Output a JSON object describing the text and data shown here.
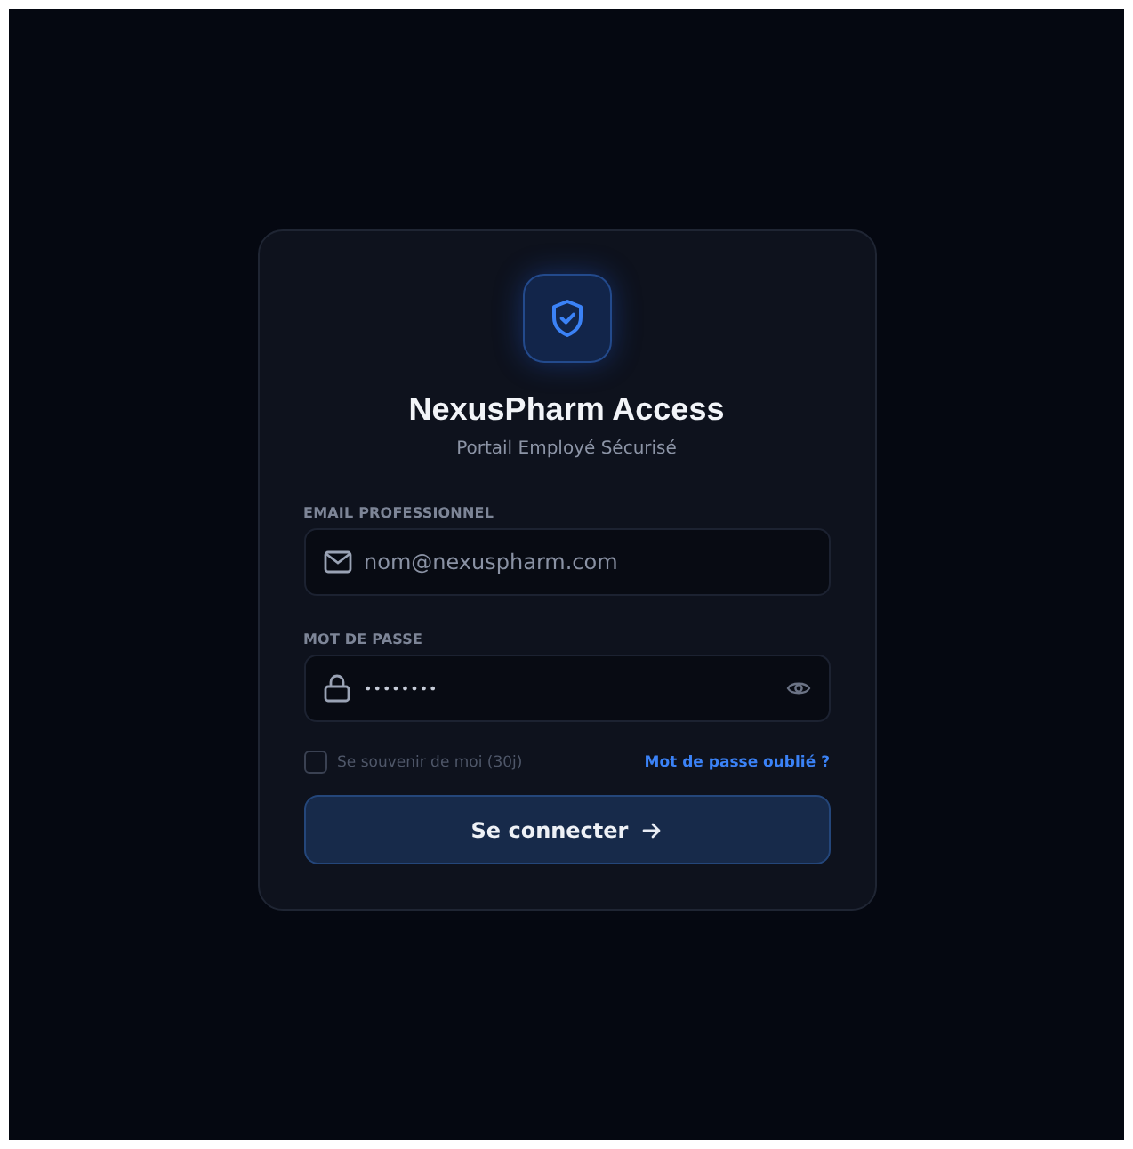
{
  "header": {
    "title": "NexusPharm Access",
    "subtitle": "Portail Employé Sécurisé"
  },
  "fields": [
    {
      "kind": "email",
      "label": "EMAIL PROFESSIONNEL",
      "placeholder": "nom@nexuspharm.com"
    },
    {
      "kind": "password",
      "label": "MOT DE PASSE",
      "value": "••••••••"
    }
  ],
  "remember": {
    "label": "Se souvenir de moi (30j)",
    "checked": false
  },
  "forgot_link": "Mot de passe oublié ?",
  "submit": "Se connecter"
}
